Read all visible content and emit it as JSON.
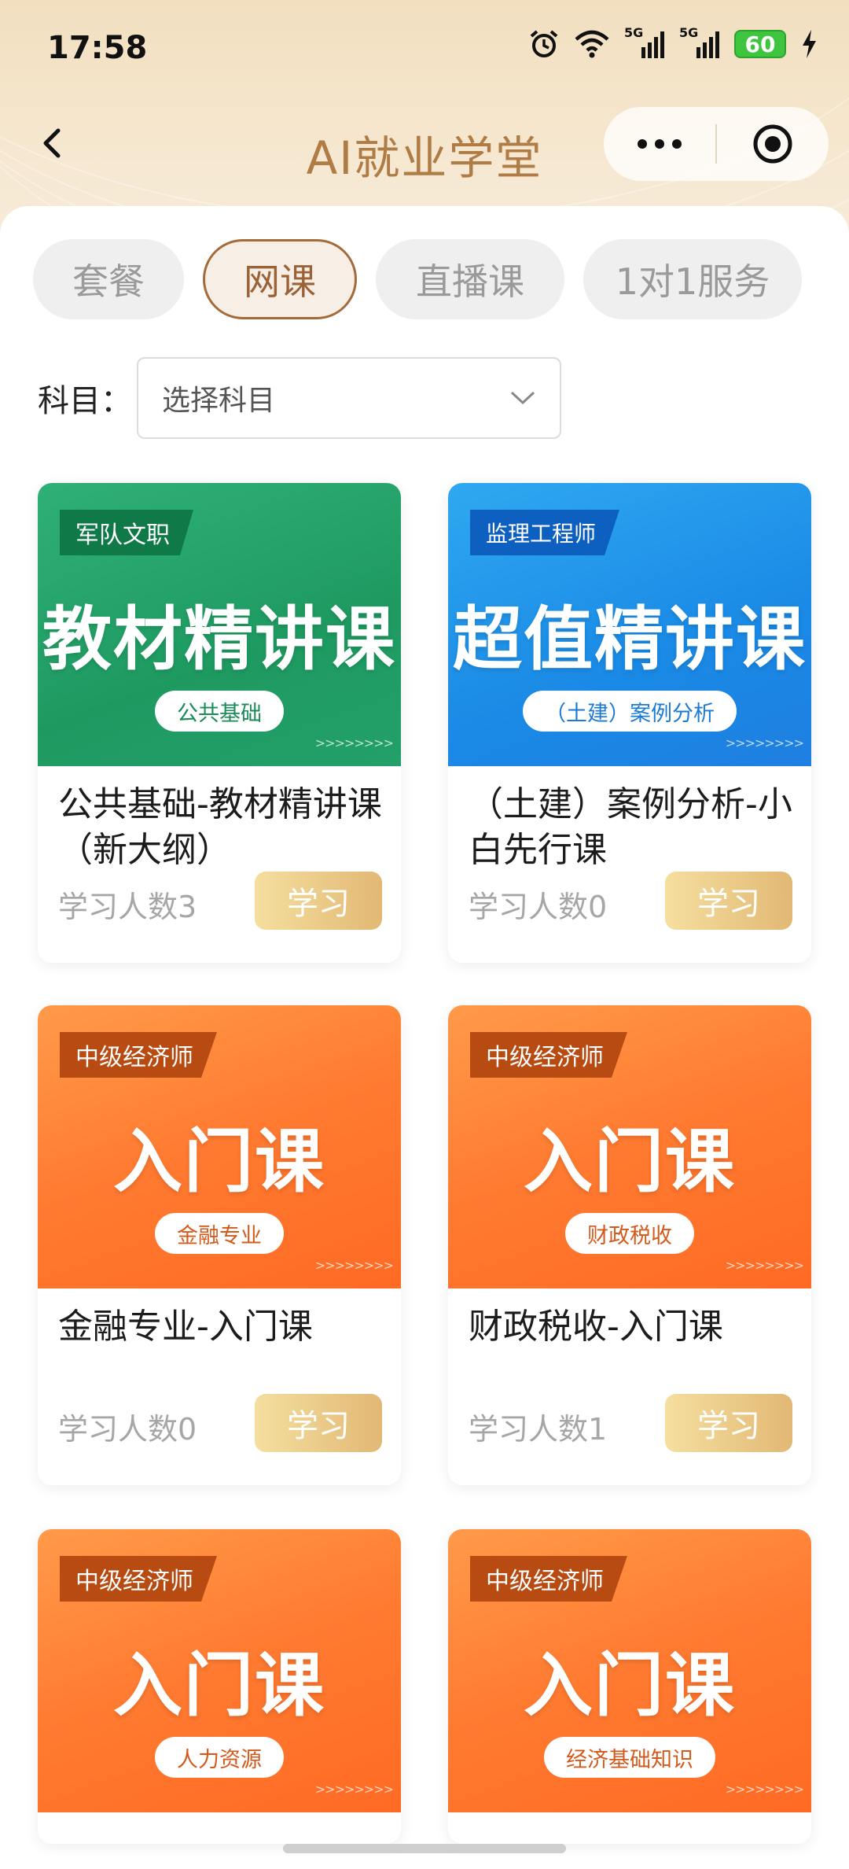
{
  "status": {
    "time": "17:58",
    "battery": "60",
    "sig1": "5G",
    "sig2": "5G"
  },
  "nav": {
    "title": "AI就业学堂"
  },
  "tabs": [
    {
      "label": "套餐",
      "active": false
    },
    {
      "label": "网课",
      "active": true
    },
    {
      "label": "直播课",
      "active": false
    },
    {
      "label": "1对1服务",
      "active": false
    }
  ],
  "filter": {
    "label": "科目：",
    "placeholder": "选择科目"
  },
  "courses": [
    {
      "theme": "green",
      "tag": "军队文职",
      "banner_title": "教材精讲课",
      "pill": "公共基础",
      "title": "公共基础-教材精讲课（新大纲）",
      "count": "学习人数3",
      "button": "学习"
    },
    {
      "theme": "blue",
      "tag": "监理工程师",
      "banner_title": "超值精讲课",
      "pill": "（土建）案例分析",
      "title": "（土建）案例分析-小白先行课",
      "count": "学习人数0",
      "button": "学习"
    },
    {
      "theme": "orange",
      "tag": "中级经济师",
      "banner_title": "入门课",
      "pill": "金融专业",
      "title": "金融专业-入门课",
      "count": "学习人数0",
      "button": "学习"
    },
    {
      "theme": "orange",
      "tag": "中级经济师",
      "banner_title": "入门课",
      "pill": "财政税收",
      "title": "财政税收-入门课",
      "count": "学习人数1",
      "button": "学习"
    },
    {
      "theme": "orange",
      "tag": "中级经济师",
      "banner_title": "入门课",
      "pill": "人力资源",
      "title": "",
      "count": "",
      "button": ""
    },
    {
      "theme": "orange",
      "tag": "中级经济师",
      "banner_title": "入门课",
      "pill": "经济基础知识",
      "title": "",
      "count": "",
      "button": ""
    }
  ],
  "colors": {
    "accent": "#a46a3a",
    "title": "#b07c45",
    "green": "#1e9a61",
    "blue": "#1a8ae6",
    "orange": "#ff7a30"
  }
}
